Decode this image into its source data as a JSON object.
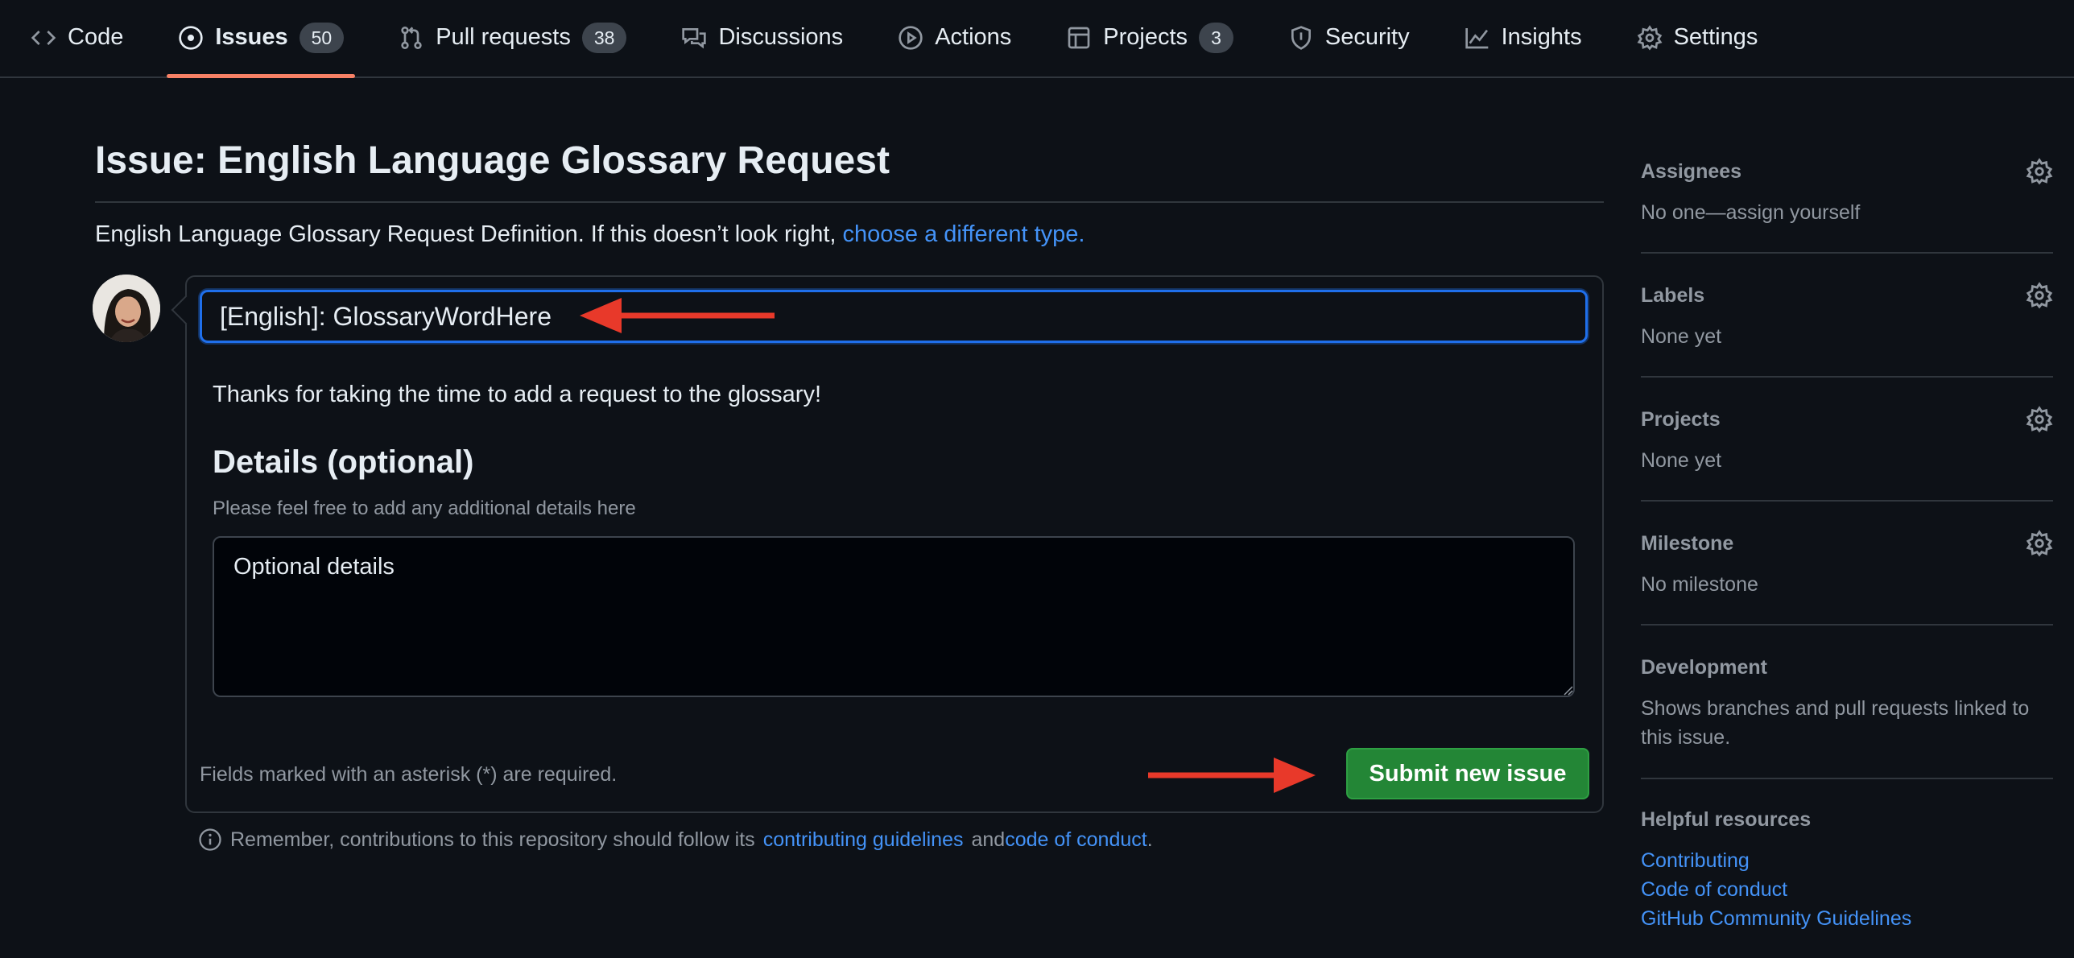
{
  "nav": {
    "tabs": [
      {
        "label": "Code",
        "icon": "code-icon"
      },
      {
        "label": "Issues",
        "icon": "issue-opened-icon",
        "count": "50"
      },
      {
        "label": "Pull requests",
        "icon": "git-pull-request-icon",
        "count": "38"
      },
      {
        "label": "Discussions",
        "icon": "comment-discussion-icon"
      },
      {
        "label": "Actions",
        "icon": "play-icon"
      },
      {
        "label": "Projects",
        "icon": "table-icon",
        "count": "3"
      },
      {
        "label": "Security",
        "icon": "shield-icon"
      },
      {
        "label": "Insights",
        "icon": "graph-icon"
      },
      {
        "label": "Settings",
        "icon": "gear-icon"
      }
    ],
    "active_tab": "Issues",
    "accent_color": "#f78166"
  },
  "page": {
    "title": "Issue: English Language Glossary Request",
    "subtitle_text": "English Language Glossary Request Definition. If this doesn’t look right,",
    "subtitle_link": "choose a different type."
  },
  "form": {
    "title_value": "[English]: GlossaryWordHere",
    "intro": "Thanks for taking the time to add a request to the glossary!",
    "details_heading": "Details (optional)",
    "details_description": "Please feel free to add any additional details here",
    "details_value": "Optional details",
    "required_note": "Fields marked with an asterisk (*) are required.",
    "submit_label": "Submit new issue",
    "submit_color": "#238636"
  },
  "footnote": {
    "text_before": "Remember, contributions to this repository should follow its",
    "link1": "contributing guidelines",
    "text_mid": "and",
    "link2": "code of conduct",
    "text_after": "."
  },
  "sidebar": {
    "assignees": {
      "heading": "Assignees",
      "value": "No one—assign yourself"
    },
    "labels": {
      "heading": "Labels",
      "value": "None yet"
    },
    "projects": {
      "heading": "Projects",
      "value": "None yet"
    },
    "milestone": {
      "heading": "Milestone",
      "value": "No milestone"
    },
    "development": {
      "heading": "Development",
      "value": "Shows branches and pull requests linked to this issue."
    },
    "helpful": {
      "heading": "Helpful resources",
      "links": [
        "Contributing",
        "Code of conduct",
        "GitHub Community Guidelines"
      ]
    }
  },
  "annotation_color": "#e8392a"
}
